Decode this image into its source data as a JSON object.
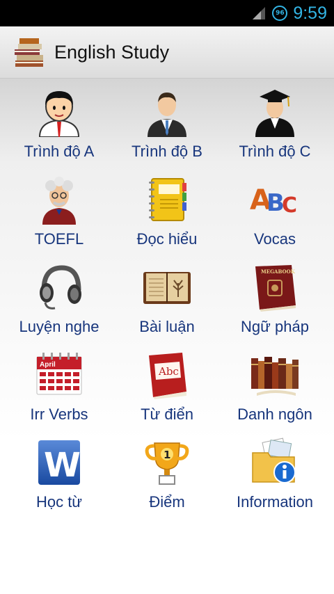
{
  "status_bar": {
    "time": "9:59",
    "sync_badge": "96",
    "accent_color": "#33b5e5"
  },
  "action_bar": {
    "title": "English Study",
    "app_icon": "books-stack-icon"
  },
  "menu": {
    "label_color": "#17357c",
    "items": [
      {
        "label": "Trình độ A",
        "icon": "student-boy-icon"
      },
      {
        "label": "Trình độ B",
        "icon": "businessman-icon"
      },
      {
        "label": "Trình độ C",
        "icon": "graduate-icon"
      },
      {
        "label": "TOEFL",
        "icon": "professor-icon"
      },
      {
        "label": "Đọc hiểu",
        "icon": "address-book-icon"
      },
      {
        "label": "Vocas",
        "icon": "abc-letters-icon"
      },
      {
        "label": "Luyện nghe",
        "icon": "headphones-icon"
      },
      {
        "label": "Bài luận",
        "icon": "open-book-icon"
      },
      {
        "label": "Ngữ pháp",
        "icon": "grammar-book-icon"
      },
      {
        "label": "Irr Verbs",
        "icon": "calendar-icon"
      },
      {
        "label": "Từ điển",
        "icon": "dictionary-icon"
      },
      {
        "label": "Danh ngôn",
        "icon": "bookshelf-icon"
      },
      {
        "label": "Học từ",
        "icon": "word-doc-icon"
      },
      {
        "label": "Điểm",
        "icon": "trophy-icon"
      },
      {
        "label": "Information",
        "icon": "info-folder-icon"
      }
    ]
  },
  "icon_text": {
    "calendar_month": "April",
    "dictionary_word": "Abc",
    "word_letter": "W",
    "trophy_rank": "1",
    "abc_a": "A",
    "abc_b": "B",
    "abc_c": "C",
    "grammar_book_title": "MEGABOOK"
  }
}
